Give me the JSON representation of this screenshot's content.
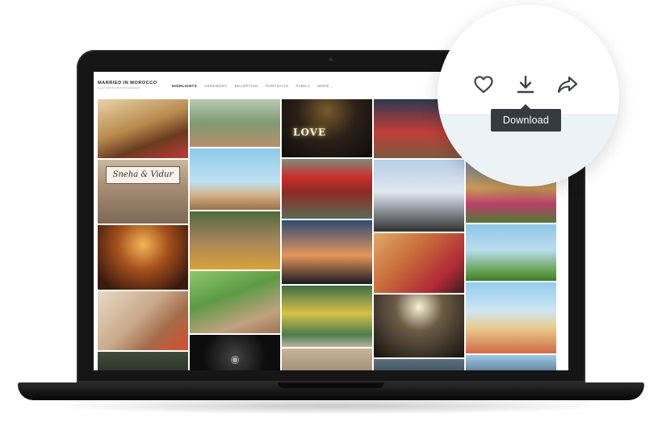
{
  "site": {
    "brand_title": "MARRIED IN MOROCCO",
    "brand_subtitle": "ALEX SMITH PHOTOGRAPHY",
    "nav": [
      {
        "label": "HIGHLIGHTS",
        "active": true
      },
      {
        "label": "CEREMONY",
        "active": false
      },
      {
        "label": "RECEPTION",
        "active": false
      },
      {
        "label": "PORTRAITS",
        "active": false
      },
      {
        "label": "FAMILY",
        "active": false
      },
      {
        "label": "MORE",
        "active": false
      }
    ],
    "more_caret": "⌄"
  },
  "gallery": {
    "sign_text": "Sneha & Vidur",
    "love_text": "LOVE"
  },
  "actions": {
    "favorite_icon": "heart-icon",
    "download_icon": "download-icon",
    "share_icon": "share-icon",
    "tooltip": "Download",
    "icon_color": "#3d4349"
  },
  "colors": {
    "tooltip_bg": "#363b40",
    "laptop_body": "#161616"
  }
}
